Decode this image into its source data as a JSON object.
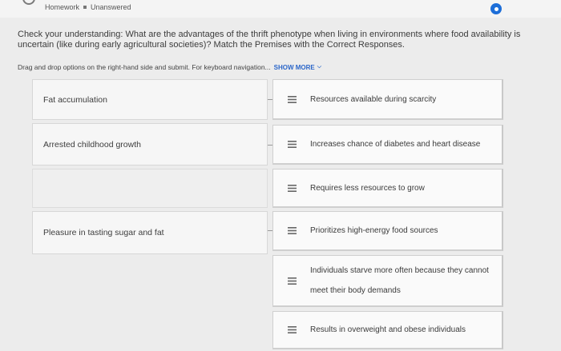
{
  "header": {
    "breadcrumb_homework": "Homework",
    "breadcrumb_status": "Unanswered"
  },
  "question": {
    "text": "Check your understanding: What are the advantages of the thrift phenotype when living in environments where food availability is uncertain (like during early agricultural societies)? Match the Premises with the Correct Responses.",
    "instructions": "Drag and drop options on the right-hand side and submit. For keyboard navigation...",
    "show_more_label": "SHOW MORE"
  },
  "premises": [
    {
      "label": "Fat accumulation"
    },
    {
      "label": "Arrested childhood growth"
    },
    {
      "label": "Pleasure in tasting sugar and fat"
    }
  ],
  "responses": [
    {
      "label": "Resources available during scarcity"
    },
    {
      "label": "Increases chance of diabetes and heart disease"
    },
    {
      "label": "Requires less resources to grow"
    },
    {
      "label": "Prioritizes high-energy food sources"
    },
    {
      "label": "Individuals starve more often because they cannot meet their body demands"
    },
    {
      "label": "Results in overweight and obese individuals"
    }
  ],
  "icons": {
    "drag_handle": "drag-handle-icon",
    "status": "unanswered-status-icon",
    "show_more": "chevron-down-icon"
  },
  "colors": {
    "accent": "#2b66c9",
    "status_circle": "#1d6ed8",
    "background": "#ececec"
  }
}
